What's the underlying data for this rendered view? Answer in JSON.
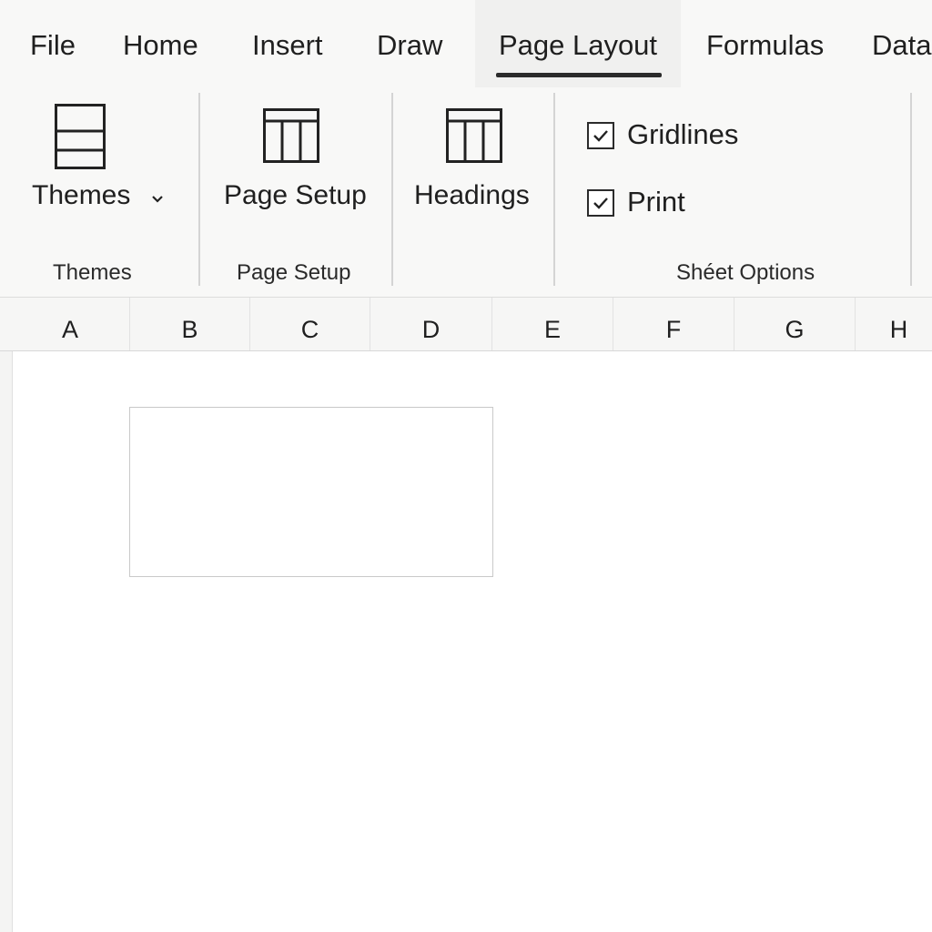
{
  "tabs": [
    {
      "label": "File"
    },
    {
      "label": "Home"
    },
    {
      "label": "Insert"
    },
    {
      "label": "Draw"
    },
    {
      "label": "Page Layout",
      "active": true
    },
    {
      "label": "Formulas"
    },
    {
      "label": "Data"
    }
  ],
  "ribbon": {
    "themes_group": {
      "button_label": "Themes",
      "group_label": "Themes",
      "icon": "themes-layout-icon"
    },
    "page_setup_group": {
      "button_label": "Page Setup",
      "group_label": "Page Setup",
      "icon": "table-columns-icon"
    },
    "headings_group": {
      "button_label": "Headings",
      "icon": "table-columns-icon"
    },
    "sheet_options_group": {
      "gridlines_label": "Gridlines",
      "gridlines_checked": true,
      "print_label": "Print",
      "print_checked": true,
      "group_label": "Shéet Options"
    }
  },
  "columns": [
    "A",
    "B",
    "C",
    "D",
    "E",
    "F",
    "G",
    "H"
  ],
  "colors": {
    "background": "#f8f8f7",
    "active_tab": "#f0f0ef",
    "underline": "#2b2b2b",
    "sheet": "#ffffff"
  }
}
